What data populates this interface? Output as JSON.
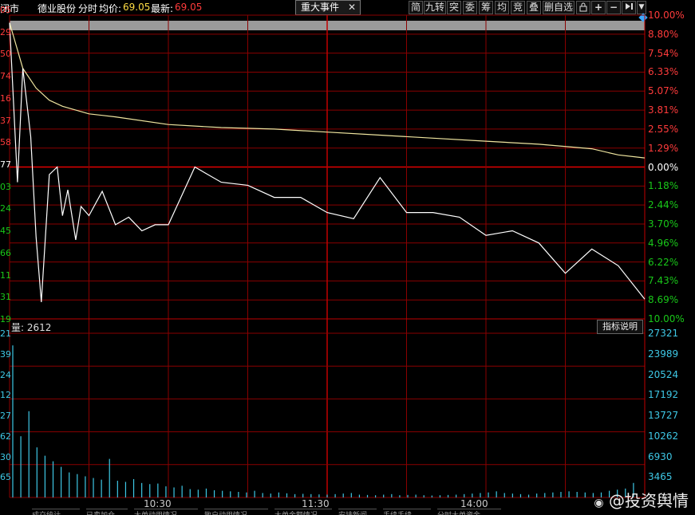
{
  "topbar": {
    "status": "闭市",
    "stock_name": "德业股份",
    "chart_mode": "分时",
    "avg_label": "均价:",
    "avg_value": "69.05",
    "latest_label": "最新:",
    "latest_value": "69.05",
    "major_events_tab": "重大事件",
    "tool_buttons": [
      "简",
      "九转",
      "突",
      "委",
      "筹",
      "均",
      "竞",
      "叠",
      "删自选"
    ]
  },
  "price_axis_right": [
    "10.00%",
    "8.80%",
    "7.54%",
    "6.33%",
    "5.07%",
    "3.81%",
    "2.55%",
    "1.29%",
    "0.00%",
    "1.18%",
    "2.44%",
    "3.70%",
    "4.96%",
    "6.22%",
    "7.43%",
    "8.69%",
    "10.00%"
  ],
  "price_axis_left_partial": [
    "05",
    "29",
    "50",
    "74",
    "16",
    "37",
    "58",
    "77",
    "03",
    "24",
    "45",
    "66",
    "11",
    "31",
    "19"
  ],
  "volume_panel": {
    "label": "量: 2612",
    "indicator_button": "指标说明",
    "axis_right": [
      "27321",
      "23989",
      "20524",
      "17192",
      "13727",
      "10262",
      "6930",
      "3465"
    ],
    "axis_left_partial": [
      "21",
      "39",
      "24",
      "12",
      "27",
      "62",
      "30",
      "65"
    ]
  },
  "time_axis": [
    "10:30",
    "11:30",
    "14:00"
  ],
  "bottom_tabs": [
    "成交统计",
    "已卖加仓",
    "大单动用情况",
    "散户动用情况",
    "大单金额情况",
    "安排新闻",
    "手续手续",
    "分时大单资金"
  ],
  "watermark": "@投资舆情",
  "colors": {
    "up": "#ff3b3b",
    "down": "#19c819",
    "grid": "#8a0000",
    "price_line": "#ffffff",
    "avg_line": "#f0e6a0",
    "volume": "#3ec8e6"
  },
  "chart_data": {
    "type": "line",
    "title": "",
    "xlabel": "",
    "ylabel": "",
    "ylim": [
      -10,
      10
    ],
    "series": [
      {
        "name": "",
        "x": [
          0,
          3,
          5,
          8,
          10,
          12,
          15,
          18,
          20,
          22,
          25,
          27,
          30,
          35,
          40,
          45,
          50,
          55,
          60,
          70,
          80,
          90,
          100,
          110,
          120,
          130,
          140,
          150,
          160,
          170,
          180,
          190,
          200,
          210,
          220,
          230,
          240
        ],
        "values": [
          9.5,
          -1.0,
          6.5,
          2.0,
          -4.6,
          -8.9,
          -0.5,
          0.0,
          -3.2,
          -1.5,
          -4.8,
          -2.6,
          -3.2,
          -1.6,
          -3.8,
          -3.3,
          -4.2,
          -3.8,
          -3.8,
          0.0,
          -1.0,
          -1.2,
          -2.0,
          -2.0,
          -3.0,
          -3.4,
          -0.7,
          -3.0,
          -3.0,
          -3.3,
          -4.5,
          -4.2,
          -5.0,
          -7.0,
          -5.4,
          -6.5,
          -8.7
        ]
      },
      {
        "name": "",
        "x": [
          0,
          5,
          10,
          15,
          20,
          30,
          40,
          60,
          80,
          100,
          120,
          140,
          160,
          180,
          200,
          220,
          230,
          240
        ],
        "values": [
          9.5,
          6.5,
          5.2,
          4.4,
          4.0,
          3.5,
          3.3,
          2.8,
          2.6,
          2.5,
          2.3,
          2.1,
          1.9,
          1.7,
          1.5,
          1.2,
          0.8,
          0.6
        ]
      }
    ],
    "volume": [
      27321,
      11000,
      15500,
      9000,
      7500,
      6500,
      5500,
      4500,
      4200,
      3800,
      3500,
      3200,
      6930,
      3000,
      2800,
      3300,
      2600,
      2400,
      2500,
      2000,
      1800,
      2100,
      1500,
      1400,
      1600,
      1300,
      1200,
      1100,
      1000,
      900,
      1200,
      800,
      700,
      900,
      750,
      600,
      650,
      600,
      550,
      500,
      600,
      700,
      800,
      500,
      450,
      400,
      500,
      600,
      400,
      450,
      500,
      400,
      350,
      400,
      450,
      500,
      600,
      700,
      800,
      900,
      1100,
      800,
      700,
      600,
      500,
      700,
      800,
      900,
      1000,
      1100,
      1000,
      900,
      800,
      900,
      1200,
      1400,
      1600,
      2612
    ]
  }
}
